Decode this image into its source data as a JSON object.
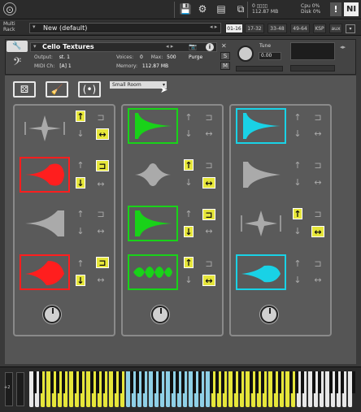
{
  "topbar": {
    "meter_labels": [
      "0 ▯▯▯▯",
      "112.87 MB"
    ],
    "cpu_label": "Cpu",
    "cpu_value": "0%",
    "disk_label": "Disk",
    "disk_value": "0%",
    "warn": "!"
  },
  "rack": {
    "label_line1": "Multi",
    "label_line2": "Rack",
    "preset": "New (default)",
    "tabs": [
      "01-16",
      "17-32",
      "33-48",
      "49-64",
      "KSP",
      "aux"
    ]
  },
  "instrument": {
    "name": "Cello Textures",
    "output_label": "Output:",
    "output_value": "st. 1",
    "midi_label": "MIDI Ch:",
    "midi_value": "[A] 1",
    "voices_label": "Voices:",
    "voices_value": "0",
    "max_label": "Max:",
    "max_value": "500",
    "purge": "Purge",
    "memory_label": "Memory:",
    "memory_value": "112.87 MB",
    "tune_label": "Tune",
    "tune_value": "0.00",
    "s_button": "S",
    "m_button": "M",
    "info": "i"
  },
  "controls": {
    "reverb_select": "Small Room"
  },
  "colors": {
    "red": "#ff1e1e",
    "green": "#19d219",
    "cyan": "#19d2e6",
    "yellow": "#e6e63a",
    "gray": "#c8c8c8"
  }
}
